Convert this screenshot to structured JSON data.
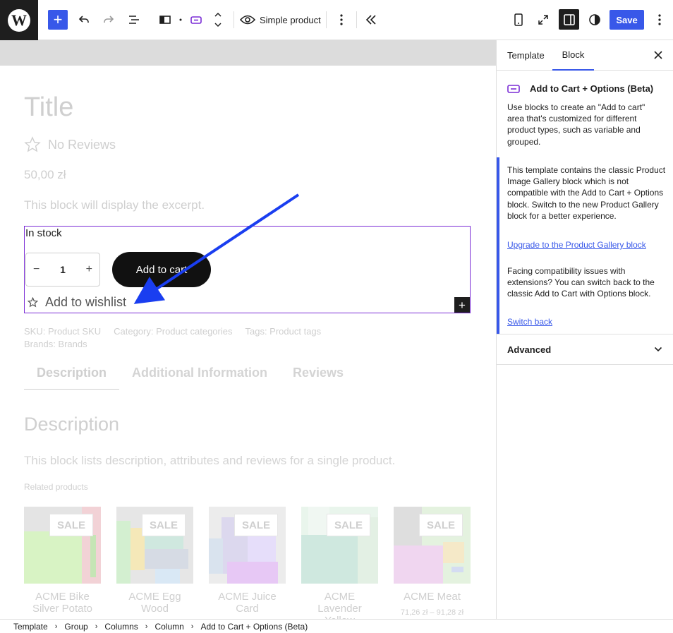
{
  "toolbar": {
    "add_label": "+",
    "preview_label": "Simple product",
    "save_label": "Save",
    "wp_logo_text": "W"
  },
  "canvas": {
    "title": "Title",
    "reviews": "No Reviews",
    "price": "50,00 zł",
    "excerpt": "This block will display the excerpt.",
    "stock": "In stock",
    "qty_value": "1",
    "qty_minus": "−",
    "qty_plus": "+",
    "add_to_cart": "Add to cart",
    "wishlist": "Add to wishlist",
    "block_add": "+",
    "sku": "SKU: Product SKU",
    "category": "Category: Product categories",
    "tags": "Tags: Product tags",
    "brands": "Brands: Brands",
    "tabs": [
      "Description",
      "Additional Information",
      "Reviews"
    ],
    "desc_heading": "Description",
    "desc_text": "This block lists description, attributes and reviews for a single product.",
    "related_label": "Related products",
    "sale_badge": "SALE",
    "products": [
      {
        "name": "ACME Bike Silver Potato",
        "price": ""
      },
      {
        "name": "ACME Egg Wood",
        "price": ""
      },
      {
        "name": "ACME Juice Card",
        "price": ""
      },
      {
        "name": "ACME Lavender Yellow",
        "price": ""
      },
      {
        "name": "ACME Meat",
        "price": "71,26 zł – 91,28 zł"
      }
    ]
  },
  "sidebar": {
    "tabs": [
      "Template",
      "Block"
    ],
    "active_tab": "Block",
    "block_title": "Add to Cart + Options (Beta)",
    "block_description": "Use blocks to create an \"Add to cart\" area that's customized for different product types, such as variable and grouped.",
    "notice_text_1": "This template contains the classic Product Image Gallery block which is not compatible with the Add to Cart + Options block. Switch to the new Product Gallery block for a better experience.",
    "notice_link_1": "Upgrade to the Product Gallery block",
    "notice_text_2": "Facing compatibility issues with extensions? You can switch back to the classic Add to Cart with Options block.",
    "notice_link_2": "Switch back",
    "advanced_label": "Advanced"
  },
  "breadcrumb": [
    "Template",
    "Group",
    "Columns",
    "Column",
    "Add to Cart + Options (Beta)"
  ],
  "colors": {
    "accent": "#3858e9",
    "block_outline": "#7a2cd6",
    "annotation_arrow": "#1a3ef0"
  }
}
